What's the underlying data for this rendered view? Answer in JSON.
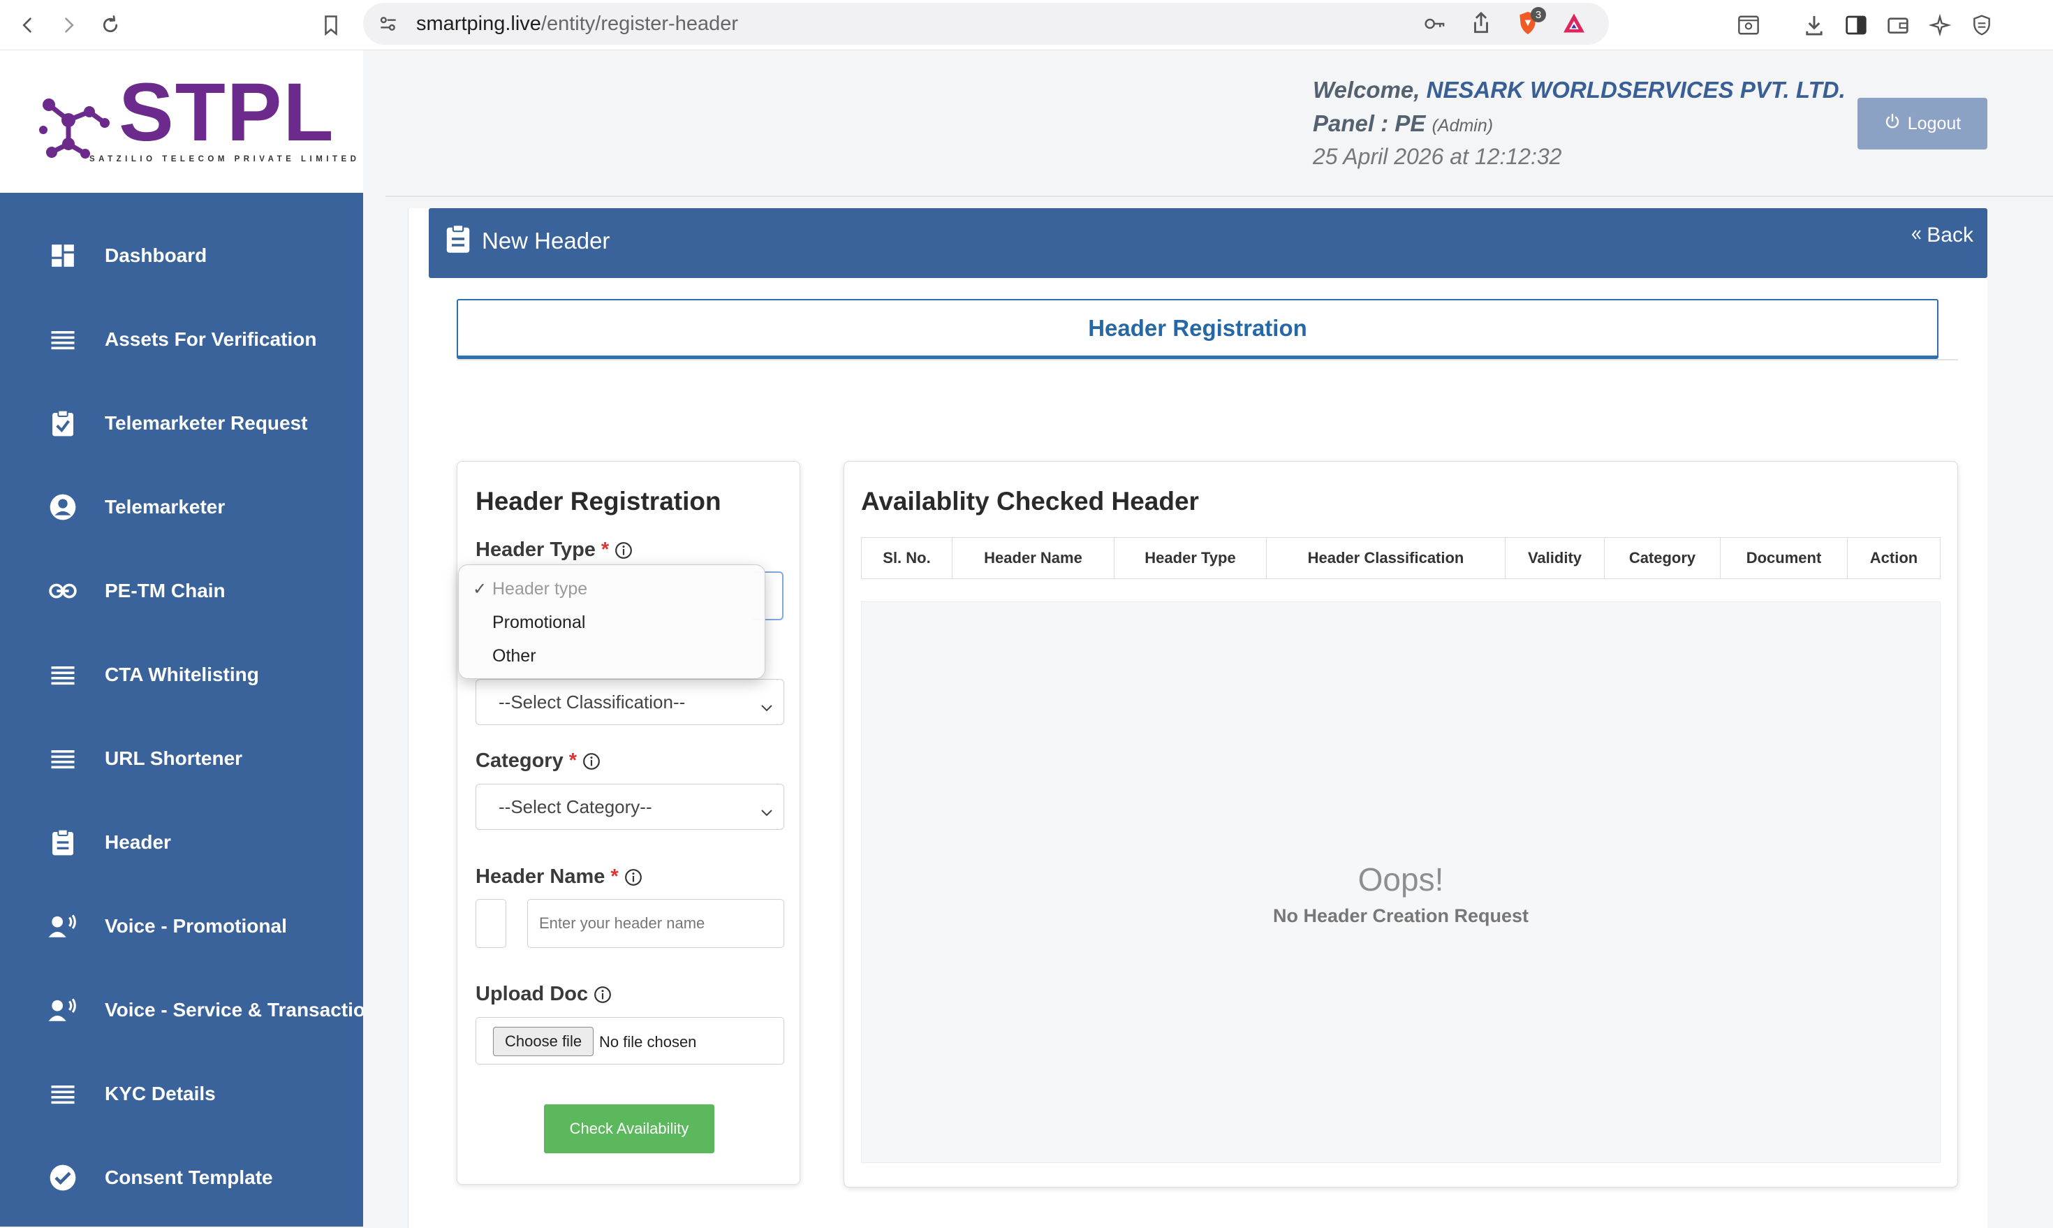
{
  "browser": {
    "url_host": "smartping.live",
    "url_path": "/entity/register-header",
    "extension_badge": "3"
  },
  "brand": {
    "logo_text": "STPL",
    "logo_subtitle": "SATZILIO TELECOM PRIVATE LIMITED",
    "logo_color": "#6c2a8c"
  },
  "sidebar": {
    "bg_color": "#3a639c",
    "items": [
      {
        "label": "Dashboard",
        "icon": "dashboard-icon"
      },
      {
        "label": "Assets For Verification",
        "icon": "list-icon"
      },
      {
        "label": "Telemarketer Request",
        "icon": "clipboard-check-icon"
      },
      {
        "label": "Telemarketer",
        "icon": "user-circle-icon"
      },
      {
        "label": "PE-TM Chain",
        "icon": "link-icon"
      },
      {
        "label": "CTA Whitelisting",
        "icon": "list-icon"
      },
      {
        "label": "URL Shortener",
        "icon": "list-icon"
      },
      {
        "label": "Header",
        "icon": "clipboard-icon"
      },
      {
        "label": "Voice - Promotional",
        "icon": "voice-user-icon"
      },
      {
        "label": "Voice - Service & Transactional",
        "icon": "voice-user-icon"
      },
      {
        "label": "KYC Details",
        "icon": "list-icon"
      },
      {
        "label": "Consent Template",
        "icon": "check-circle-icon"
      }
    ]
  },
  "header": {
    "welcome_prefix": "Welcome, ",
    "company": "NESARK WORLDSERVICES PVT. LTD.",
    "panel_prefix": "Panel : PE ",
    "panel_role": "(Admin)",
    "datetime": "25 April 2026 at 12:12:32",
    "logout_label": "Logout"
  },
  "page": {
    "title": "New Header",
    "back_label": "Back",
    "tab_label": "Header Registration"
  },
  "form": {
    "title": "Header Registration",
    "header_type_label": "Header Type",
    "required_mark": "*",
    "classification_placeholder": "--Select Classification--",
    "category_label": "Category",
    "category_placeholder": "--Select Category--",
    "header_name_label": "Header Name",
    "header_name_placeholder": "Enter your header name",
    "upload_label": "Upload Doc",
    "choose_file_label": "Choose file",
    "no_file_label": "No file chosen",
    "check_button_label": "Check Availability"
  },
  "header_type_dropdown": {
    "selected_mark": "✓",
    "options": [
      "Header type",
      "Promotional",
      "Other"
    ]
  },
  "table": {
    "title": "Availablity Checked Header",
    "columns": [
      "Sl. No.",
      "Header Name",
      "Header Type",
      "Header Classification",
      "Validity",
      "Category",
      "Document",
      "Action"
    ],
    "empty_title": "Oops!",
    "empty_subtitle": "No Header Creation Request"
  }
}
